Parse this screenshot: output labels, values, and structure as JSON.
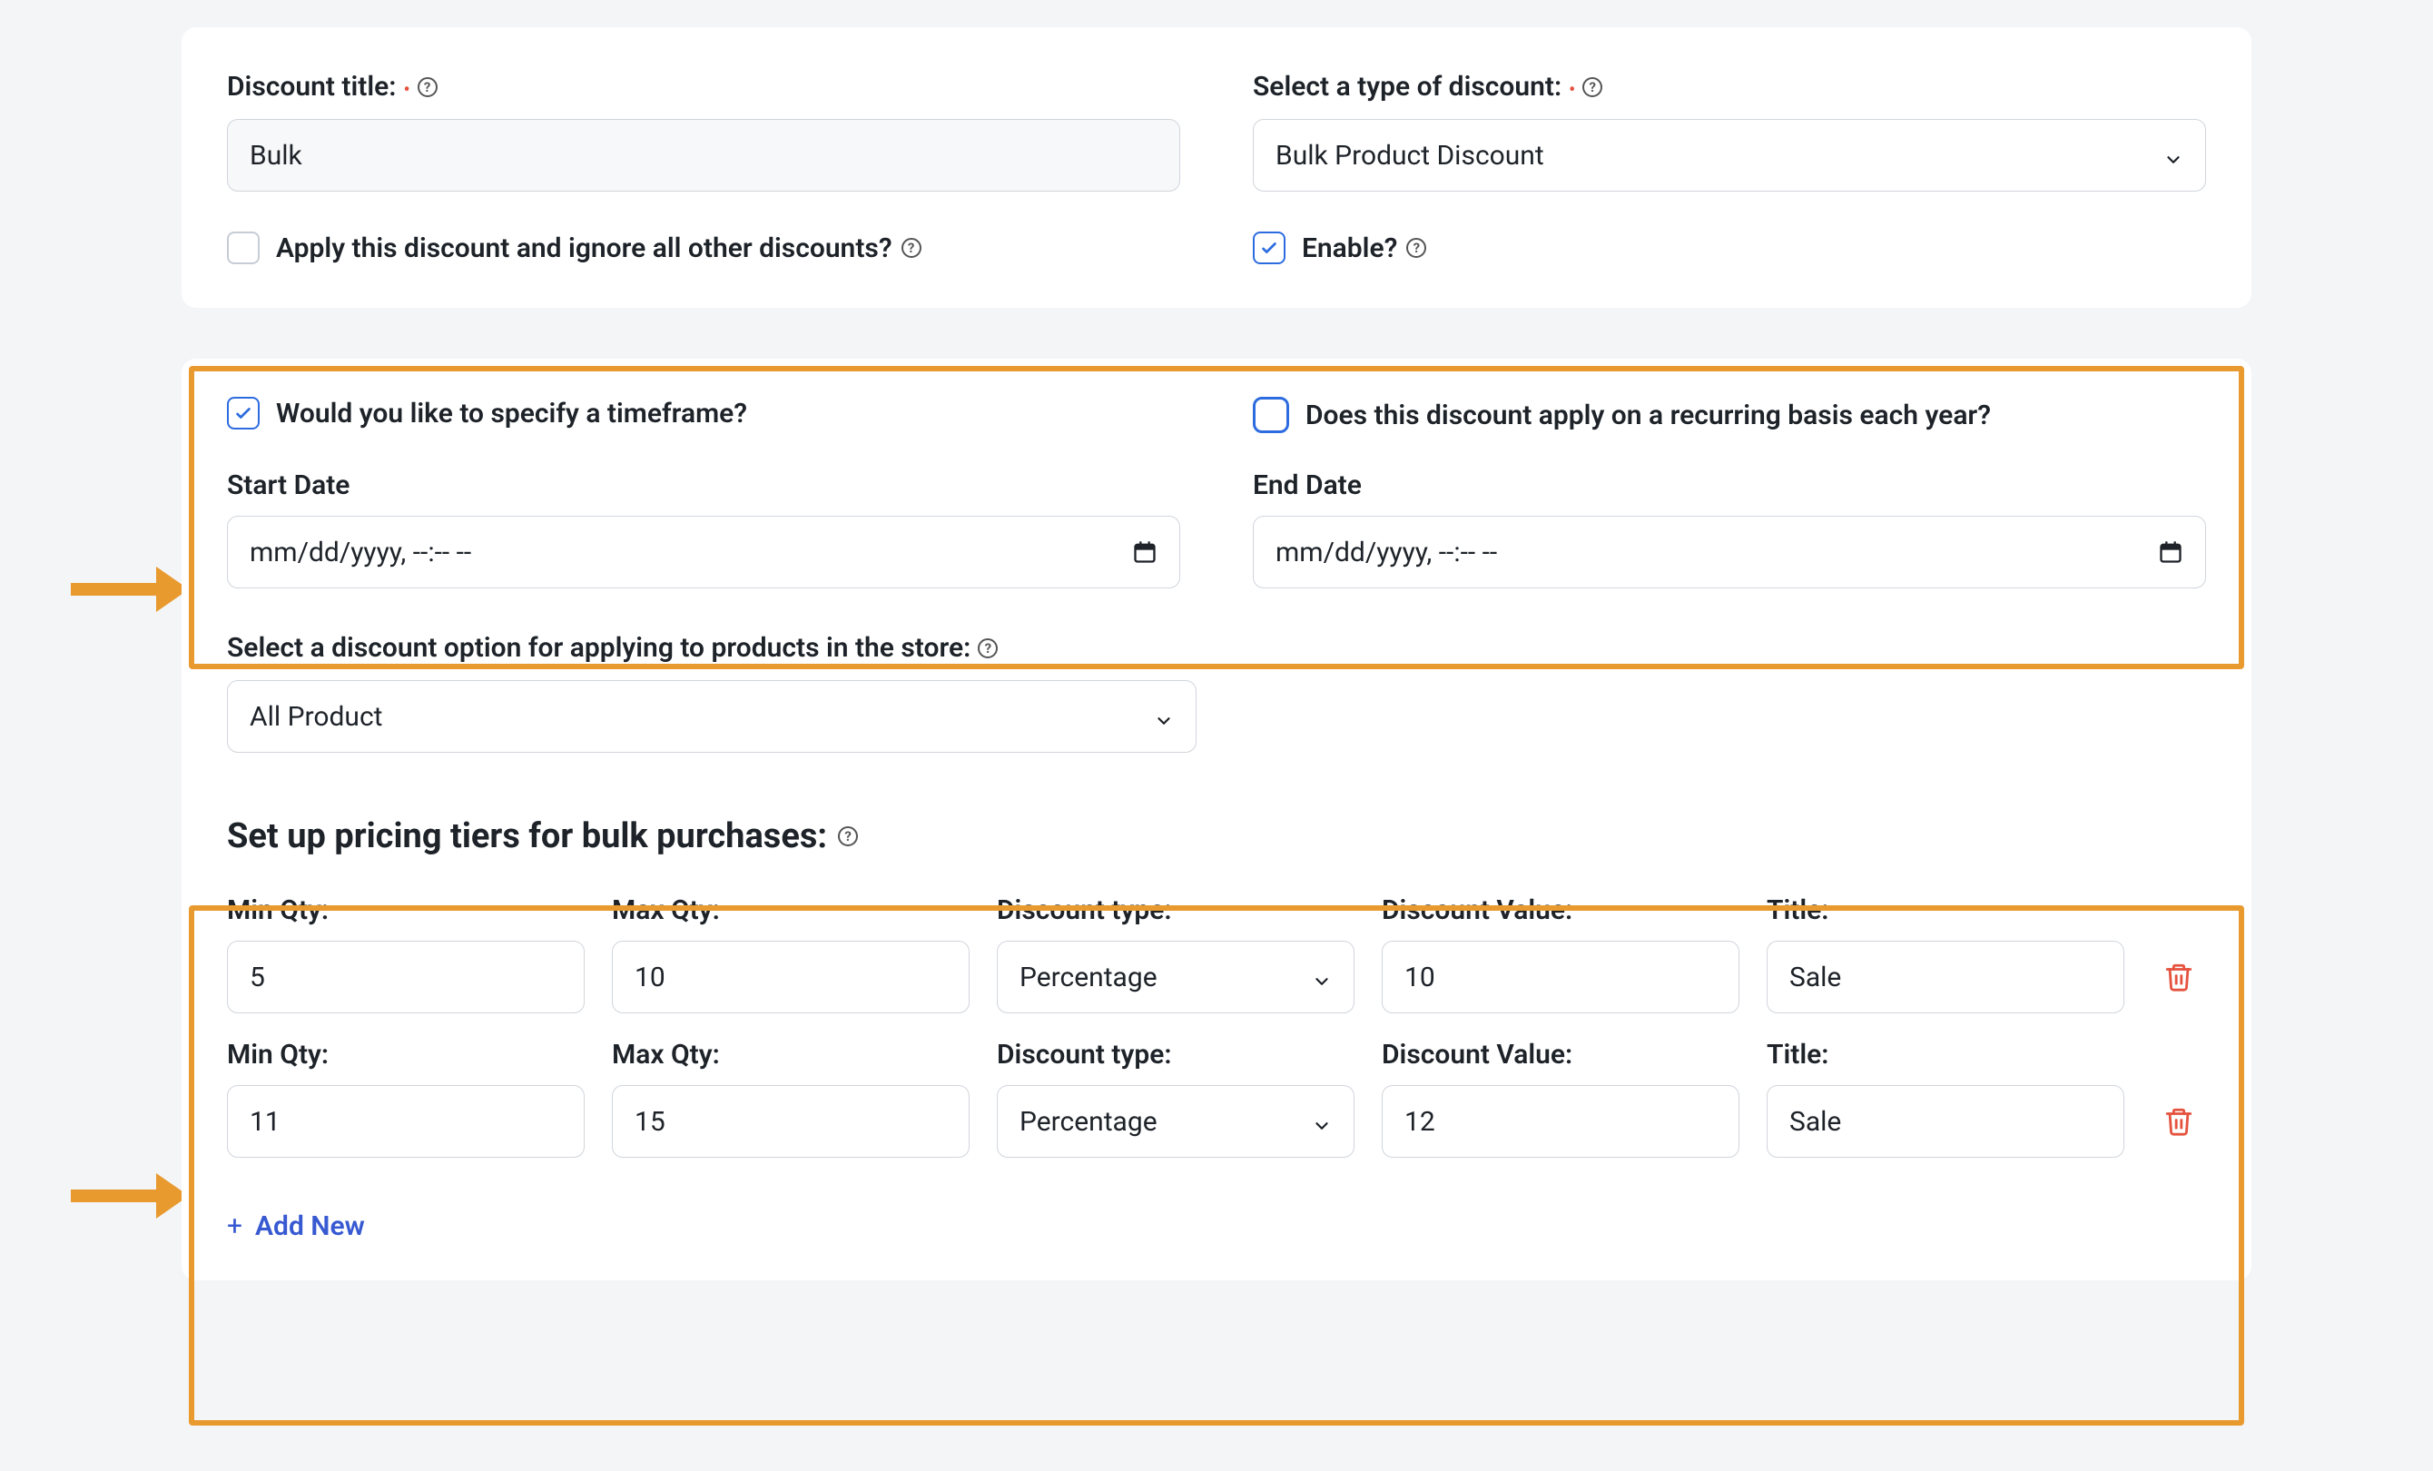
{
  "card1": {
    "title_label": "Discount title:",
    "title_value": "Bulk",
    "type_label": "Select a type of discount:",
    "type_value": "Bulk Product Discount",
    "ignore_label": "Apply this discount and ignore all other discounts?",
    "ignore_checked": false,
    "enable_label": "Enable?",
    "enable_checked": true
  },
  "card2": {
    "timeframe_label": "Would you like to specify a timeframe?",
    "timeframe_checked": true,
    "recurring_label": "Does this discount apply on a recurring basis each year?",
    "recurring_checked": false,
    "start_date_label": "Start Date",
    "start_date_placeholder": "mm/dd/yyyy, --:-- --",
    "end_date_label": "End Date",
    "end_date_placeholder": "mm/dd/yyyy, --:-- --",
    "option_label": "Select a discount option for applying to products in the store:",
    "option_value": "All Product",
    "tiers_title": "Set up pricing tiers for bulk purchases:",
    "headers": {
      "min_qty": "Min Qty:",
      "max_qty": "Max Qty:",
      "discount_type": "Discount type:",
      "discount_value": "Discount Value:",
      "title": "Title:"
    },
    "tiers": [
      {
        "min_qty": "5",
        "max_qty": "10",
        "discount_type": "Percentage",
        "discount_value": "10",
        "title": "Sale"
      },
      {
        "min_qty": "11",
        "max_qty": "15",
        "discount_type": "Percentage",
        "discount_value": "12",
        "title": "Sale"
      }
    ],
    "add_new_label": "Add New"
  },
  "colors": {
    "highlight": "#e89a2f",
    "primary": "#2d6cdf",
    "danger": "#e5533f"
  }
}
